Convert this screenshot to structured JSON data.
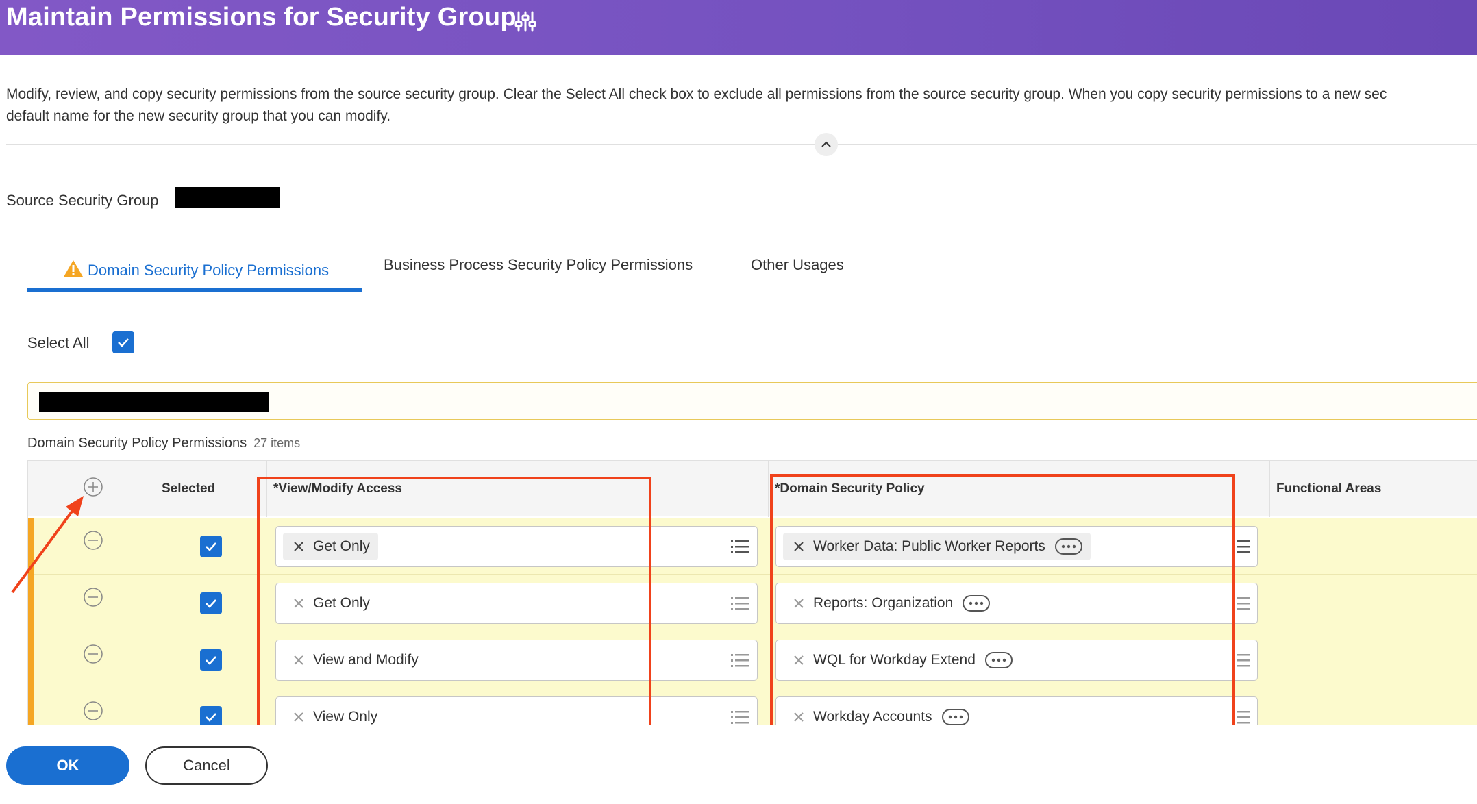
{
  "header": {
    "title": "Maintain Permissions for Security Group",
    "related_actions_icon": "sliders-icon"
  },
  "description": {
    "line1": "Modify, review, and copy security permissions from the source security group. Clear the Select All check box to exclude all permissions from the source security group. When you copy security permissions to a new sec",
    "line2": "default name for the new security group that you can modify."
  },
  "source": {
    "label": "Source Security Group",
    "value_redacted": true
  },
  "tabs": [
    {
      "label": "Domain Security Policy Permissions",
      "active": true,
      "icon": "warning-icon"
    },
    {
      "label": "Business Process Security Policy Permissions",
      "active": false
    },
    {
      "label": "Other Usages",
      "active": false
    }
  ],
  "select_all": {
    "label": "Select All",
    "checked": true
  },
  "grid": {
    "title": "Domain Security Policy Permissions",
    "count": "27 items",
    "columns": {
      "selected": "Selected",
      "access": "*View/Modify Access",
      "policy": "*Domain Security Policy",
      "functional": "Functional Areas"
    },
    "rows": [
      {
        "selected": true,
        "access": "Get Only",
        "policy": "Worker Data: Public Worker Reports"
      },
      {
        "selected": true,
        "access": "Get Only",
        "policy": "Reports: Organization"
      },
      {
        "selected": true,
        "access": "View and Modify",
        "policy": "WQL for Workday Extend"
      },
      {
        "selected": true,
        "access": "View Only",
        "policy": "Workday Accounts"
      }
    ]
  },
  "footer": {
    "ok_label": "OK",
    "cancel_label": "Cancel"
  },
  "colors": {
    "header": "#7552c0",
    "primary": "#1a6fd1",
    "row_highlight": "#fcfacd",
    "row_marker": "#f5a623",
    "annotation": "#f0421b"
  }
}
